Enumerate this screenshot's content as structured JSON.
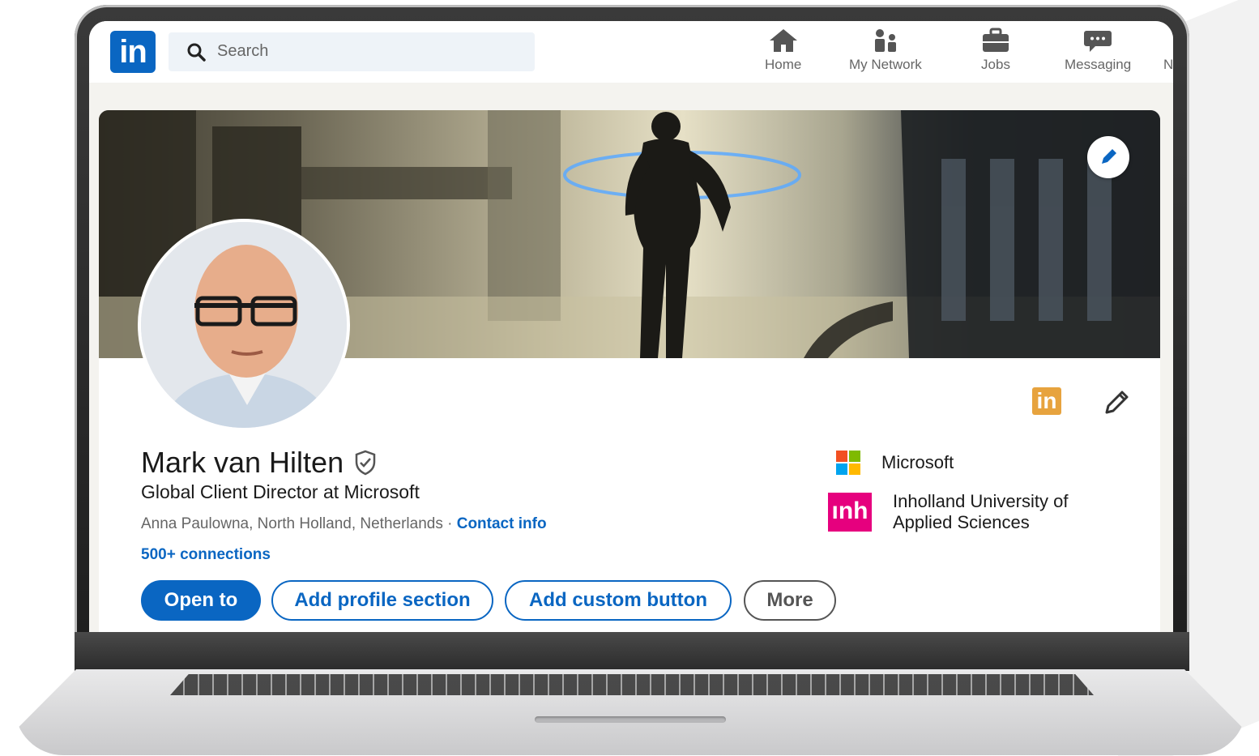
{
  "nav": {
    "logo_text": "in",
    "search_placeholder": "Search",
    "items": [
      {
        "label": "Home",
        "icon": "home-icon"
      },
      {
        "label": "My Network",
        "icon": "network-icon"
      },
      {
        "label": "Jobs",
        "icon": "briefcase-icon"
      },
      {
        "label": "Messaging",
        "icon": "messaging-icon"
      },
      {
        "label": "N",
        "icon": "notifications-icon"
      }
    ]
  },
  "profile": {
    "name": "Mark van Hilten",
    "headline": "Global Client Director at Microsoft",
    "location": "Anna Paulowna, North Holland, Netherlands",
    "location_separator": " · ",
    "contact_label": "Contact info",
    "connections": "500+ connections",
    "badge_text": "in"
  },
  "organizations": [
    {
      "name": "Microsoft",
      "logo": "microsoft-logo"
    },
    {
      "name_line1": "Inholland University of",
      "name_line2": "Applied Sciences",
      "logo": "inholland-logo",
      "logo_text": "ınh"
    }
  ],
  "buttons": {
    "open_to": "Open to",
    "add_profile_section": "Add profile section",
    "add_custom_button": "Add custom button",
    "more": "More"
  },
  "colors": {
    "linkedin_blue": "#0a66c2",
    "badge_orange": "#e7a33e",
    "inholland_pink": "#e6007e"
  }
}
